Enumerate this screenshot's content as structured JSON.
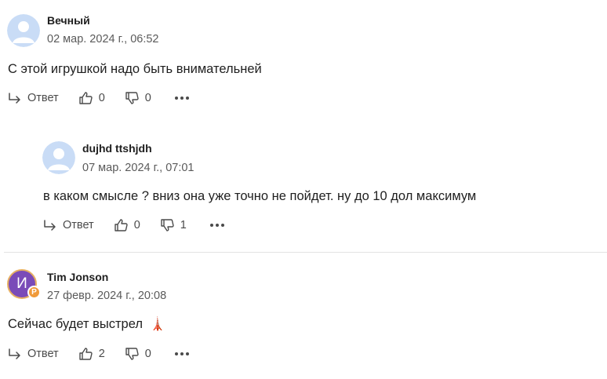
{
  "comments": [
    {
      "author": "Вечный",
      "date": "02 мар. 2024 г., 06:52",
      "text": "С этой игрушкой надо быть внимательней",
      "reply_label": "Ответ",
      "likes": "0",
      "dislikes": "0"
    },
    {
      "author": "dujhd ttshjdh",
      "date": "07 мар. 2024 г., 07:01",
      "text": "в каком смысле ? вниз она уже точно не пойдет. ну до 10 дол максимум",
      "reply_label": "Ответ",
      "likes": "0",
      "dislikes": "1"
    },
    {
      "author": "Tim Jonson",
      "avatar_initial": "И",
      "badge": "Р",
      "date": "27 февр. 2024 г., 20:08",
      "text": "Сейчас будет выстрел",
      "emoji": "🗼",
      "reply_label": "Ответ",
      "likes": "2",
      "dislikes": "0"
    }
  ],
  "icons": {
    "reply": "reply-arrow-icon",
    "like": "thumbs-up-icon",
    "dislike": "thumbs-down-icon",
    "more": "more-dots-icon"
  },
  "colors": {
    "avatar_placeholder": "#c9dcf6",
    "avatar_initial_bg": "#7a4bb8",
    "badge": "#f09a3a",
    "muted_text": "#5a5a5a"
  }
}
